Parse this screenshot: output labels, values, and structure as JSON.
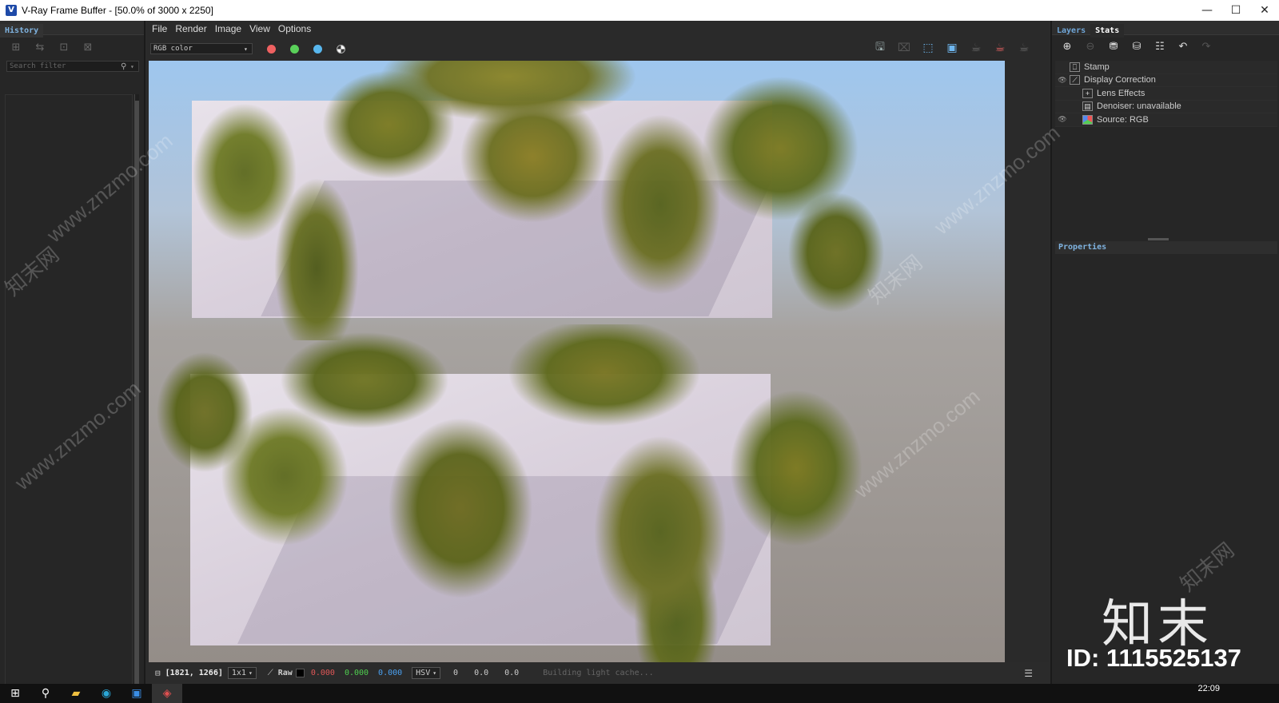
{
  "window": {
    "title": "V-Ray Frame Buffer - [50.0% of 3000 x 2250]",
    "app_icon": "vray-icon",
    "buttons": [
      "minimize",
      "maximize",
      "close"
    ]
  },
  "history_panel": {
    "tab": "History",
    "search_placeholder": "Search filter"
  },
  "menu": [
    "File",
    "Render",
    "Image",
    "View",
    "Options"
  ],
  "toolbar": {
    "channel": "RGB color",
    "channel_dots": {
      "red": "#ef6161",
      "green": "#5ad05a",
      "blue": "#58b7ee"
    }
  },
  "status_bar": {
    "coords": "[1821, 1266]",
    "zoom": "1x1",
    "mode": "Raw",
    "r": "0.000",
    "g": "0.000",
    "b": "0.000",
    "colorspace": "HSV",
    "h": "0",
    "s": "0.0",
    "v": "0.0",
    "message": "Building light cache..."
  },
  "layers_panel": {
    "tabs": [
      "Layers",
      "Stats"
    ],
    "layers": [
      {
        "name": "Stamp",
        "visible": false,
        "indent": 0
      },
      {
        "name": "Display Correction",
        "visible": true,
        "indent": 0
      },
      {
        "name": "Lens Effects",
        "visible": false,
        "indent": 1
      },
      {
        "name": "Denoiser: unavailable",
        "visible": false,
        "indent": 1
      },
      {
        "name": "Source: RGB",
        "visible": true,
        "indent": 1
      }
    ],
    "properties_label": "Properties"
  },
  "watermark": {
    "brand": "知末",
    "id": "ID: 1115525137",
    "site": "www.znzmo.com",
    "short": "知末网"
  },
  "taskbar": {
    "time": "22:09"
  }
}
